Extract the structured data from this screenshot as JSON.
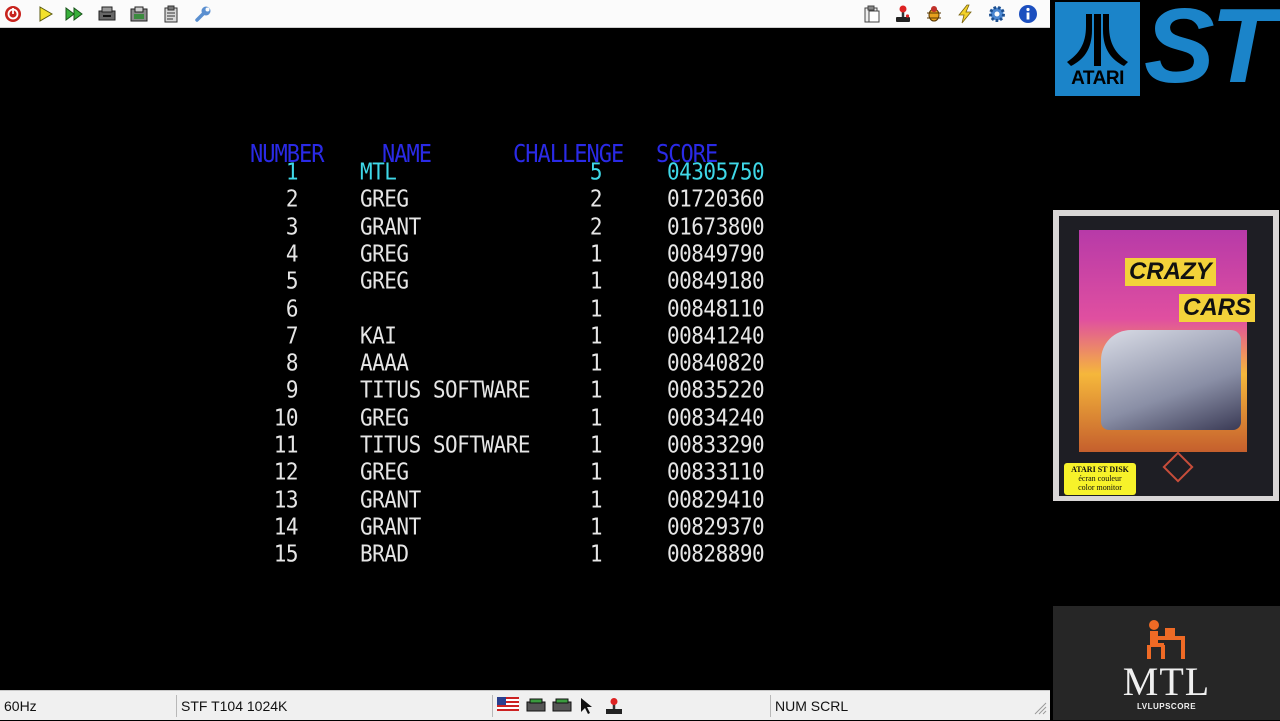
{
  "toolbar": {
    "left_icons": [
      "power-icon",
      "play-icon",
      "fast-forward-icon",
      "disk-drive-icon",
      "snapshot-save-icon",
      "clipboard-icon",
      "wrench-icon"
    ],
    "right_icons": [
      "paste-icon",
      "joystick-icon",
      "debugger-icon",
      "lightning-icon",
      "gear-icon",
      "info-icon"
    ]
  },
  "highscore": {
    "headers": {
      "number": "NUMBER",
      "name": "NAME",
      "challenge": "CHALLENGE",
      "score": "SCORE"
    },
    "rows": [
      {
        "number": "1",
        "name": "MTL",
        "challenge": "5",
        "score": "04305750"
      },
      {
        "number": "2",
        "name": "GREG",
        "challenge": "2",
        "score": "01720360"
      },
      {
        "number": "3",
        "name": "GRANT",
        "challenge": "2",
        "score": "01673800"
      },
      {
        "number": "4",
        "name": "GREG",
        "challenge": "1",
        "score": "00849790"
      },
      {
        "number": "5",
        "name": "GREG",
        "challenge": "1",
        "score": "00849180"
      },
      {
        "number": "6",
        "name": "",
        "challenge": "1",
        "score": "00848110"
      },
      {
        "number": "7",
        "name": "KAI",
        "challenge": "1",
        "score": "00841240"
      },
      {
        "number": "8",
        "name": "AAAA",
        "challenge": "1",
        "score": "00840820"
      },
      {
        "number": "9",
        "name": "TITUS SOFTWARE",
        "challenge": "1",
        "score": "00835220"
      },
      {
        "number": "10",
        "name": "GREG",
        "challenge": "1",
        "score": "00834240"
      },
      {
        "number": "11",
        "name": "TITUS SOFTWARE",
        "challenge": "1",
        "score": "00833290"
      },
      {
        "number": "12",
        "name": "GREG",
        "challenge": "1",
        "score": "00833110"
      },
      {
        "number": "13",
        "name": "GRANT",
        "challenge": "1",
        "score": "00829410"
      },
      {
        "number": "14",
        "name": "GRANT",
        "challenge": "1",
        "score": "00829370"
      },
      {
        "number": "15",
        "name": "BRAD",
        "challenge": "1",
        "score": "00828890"
      }
    ],
    "highlight_row": 1
  },
  "statusbar": {
    "refresh": "60Hz",
    "machine": "STF T104 1024K",
    "locks": "NUM SCRL"
  },
  "branding": {
    "atari_word": "ATARI",
    "st_word": "ST",
    "boxart": {
      "title_line1": "CRAZY",
      "title_line2": "CARS",
      "disk_label_1": "ATARI ST DISK",
      "disk_label_2": "écran couleur",
      "disk_label_3": "color monitor"
    },
    "mtl_word": "MTL",
    "mtl_sub": "LVLUPSCORE"
  },
  "colors": {
    "header_blue": "#2a2ae6",
    "row_white": "#e6e6e6",
    "highlight_cyan": "#3fd8e8",
    "atari_blue": "#1b84c9"
  }
}
